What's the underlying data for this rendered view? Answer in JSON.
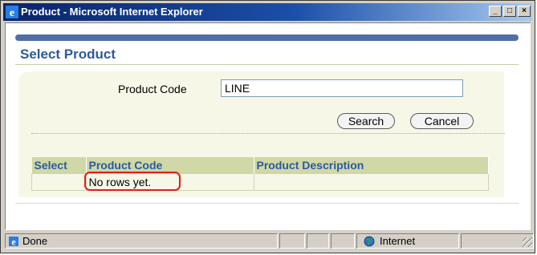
{
  "window": {
    "title": "Product - Microsoft Internet Explorer",
    "controls": {
      "minimize": "_",
      "maximize": "□",
      "close": "×"
    }
  },
  "page": {
    "title": "Select Product",
    "search": {
      "label": "Product Code",
      "value": "LINE",
      "search_button": "Search",
      "cancel_button": "Cancel"
    },
    "table": {
      "headers": [
        "Select",
        "Product Code",
        "Product Description"
      ],
      "empty_message": "No rows yet."
    }
  },
  "statusbar": {
    "status": "Done",
    "zone": "Internet"
  },
  "colors": {
    "title_blue": "#2d5a9c",
    "header_green": "#cfd8a6",
    "panel_bg": "#f7f7e7",
    "highlight_red": "#e41b1b"
  }
}
